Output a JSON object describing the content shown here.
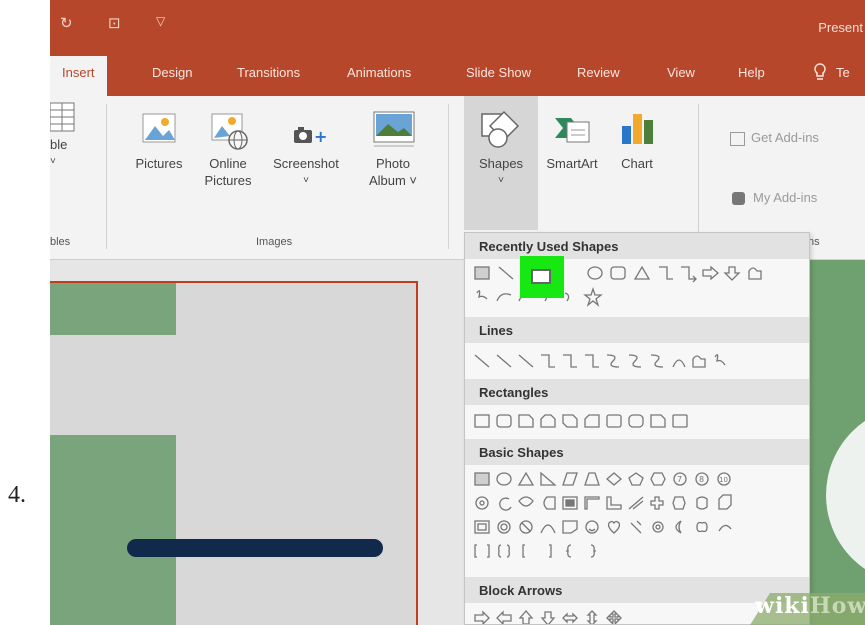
{
  "step_number": "4.",
  "titlebar": {
    "title": "Present"
  },
  "tabs": [
    {
      "label": "Insert",
      "active": true
    },
    {
      "label": "Design"
    },
    {
      "label": "Transitions"
    },
    {
      "label": "Animations"
    },
    {
      "label": "Slide Show"
    },
    {
      "label": "Review"
    },
    {
      "label": "View"
    },
    {
      "label": "Help"
    },
    {
      "label": "Te"
    }
  ],
  "ribbon": {
    "table_label": "ble",
    "tables_group": "bles",
    "pictures": "Pictures",
    "online_pictures_1": "Online",
    "online_pictures_2": "Pictures",
    "screenshot": "Screenshot",
    "photo_album_1": "Photo",
    "photo_album_2": "Album ˅",
    "images_group": "Images",
    "shapes": "Shapes",
    "smartart": "SmartArt",
    "chart": "Chart",
    "get_addins": "Get Add-ins",
    "my_addins": "My Add-ins",
    "addins_group": "ns"
  },
  "dropdown": {
    "sections": [
      {
        "title": "Recently Used Shapes"
      },
      {
        "title": "Lines"
      },
      {
        "title": "Rectangles"
      },
      {
        "title": "Basic Shapes"
      },
      {
        "title": "Block Arrows"
      }
    ]
  },
  "watermark": {
    "wiki": "wiki",
    "how": "How"
  },
  "colors": {
    "ribbon_accent": "#b7472a",
    "highlight": "#17e812",
    "slide_green": "#7aa57c",
    "nav_bar": "#112a4b"
  }
}
